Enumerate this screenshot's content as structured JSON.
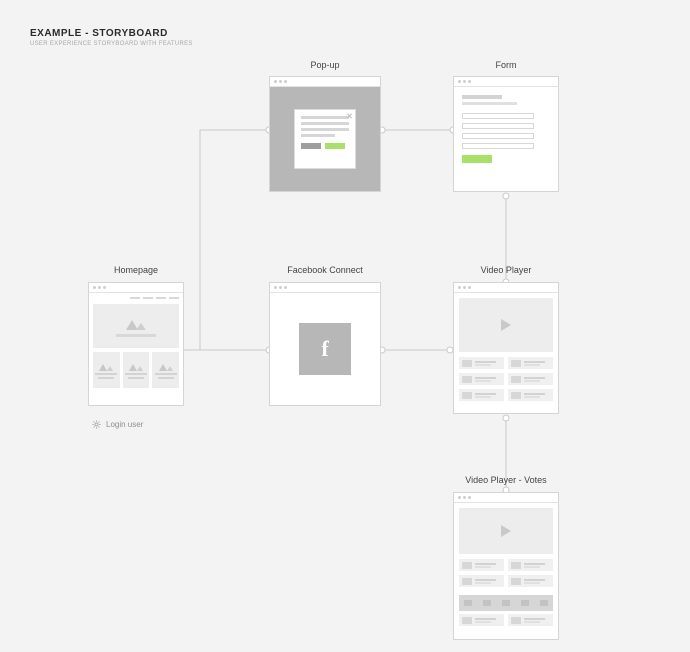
{
  "header": {
    "title": "EXAMPLE - STORYBOARD",
    "subtitle": "USER EXPERIENCE STORYBOARD WITH FEATURES"
  },
  "screens": {
    "homepage": {
      "label": "Homepage"
    },
    "popup": {
      "label": "Pop-up"
    },
    "form": {
      "label": "Form"
    },
    "facebook": {
      "label": "Facebook Connect",
      "letter": "f"
    },
    "video": {
      "label": "Video Player"
    },
    "votes": {
      "label": "Video Player - Votes"
    }
  },
  "annotation": {
    "login_user": "Login user"
  }
}
